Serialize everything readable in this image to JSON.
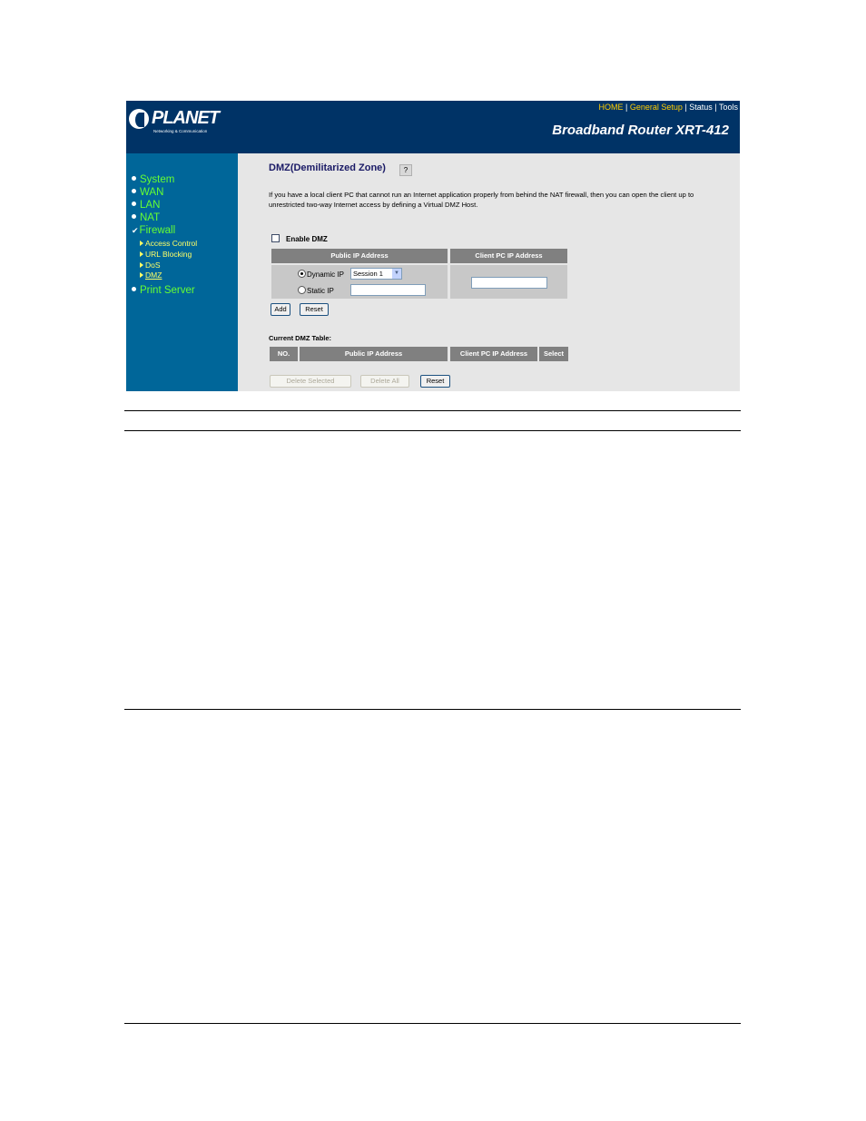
{
  "header": {
    "brand": "PLANET",
    "tagline": "Networking & Communication",
    "product": "Broadband Router XRT-412",
    "nav": {
      "home": "HOME",
      "general_setup": "General Setup",
      "status": "Status",
      "tools": "Tools",
      "sep": " | "
    }
  },
  "sidebar": {
    "items": [
      {
        "label": "System"
      },
      {
        "label": "WAN"
      },
      {
        "label": "LAN"
      },
      {
        "label": "NAT"
      },
      {
        "label": "Firewall"
      },
      {
        "label": "Print Server"
      }
    ],
    "firewall_sub": [
      {
        "label": "Access Control"
      },
      {
        "label": "URL Blocking"
      },
      {
        "label": "DoS"
      },
      {
        "label": "DMZ"
      }
    ],
    "check_mark": "✔"
  },
  "main": {
    "title": "DMZ(Demilitarized Zone)",
    "help_icon_text": "?",
    "intro": "If you have a local client PC that cannot run an Internet application properly from behind the NAT firewall, then you can open the client up to unrestricted two-way Internet access by defining a Virtual DMZ Host.",
    "enable_dmz_label": "Enable DMZ",
    "enable_dmz_checked": false,
    "form_table": {
      "col_public": "Public IP Address",
      "col_client": "Client PC IP Address",
      "dynamic_ip_label": "Dynamic IP",
      "dynamic_ip_selected": true,
      "session_value": "Session 1",
      "static_ip_label": "Static IP",
      "static_ip_value": "",
      "client_ip_value": ""
    },
    "add_button": "Add",
    "reset_button": "Reset",
    "current_table_title": "Current DMZ Table:",
    "current_table_headers": [
      "NO.",
      "Public IP Address",
      "Client PC IP Address",
      "Select"
    ],
    "delete_selected_button": "Delete Selected",
    "delete_all_button": "Delete All",
    "reset_table_button": "Reset"
  }
}
